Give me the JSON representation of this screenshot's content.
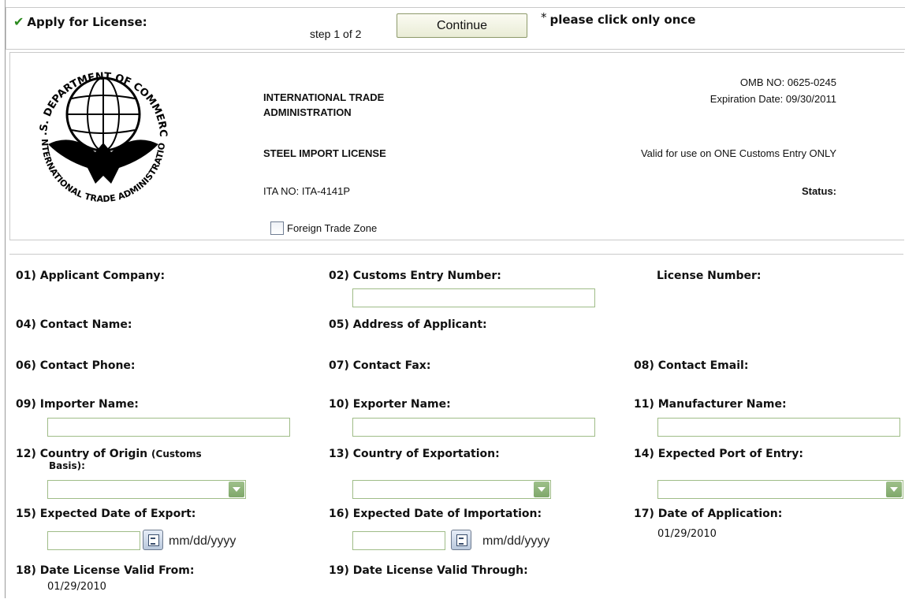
{
  "topbar": {
    "apply_label": "Apply for License:",
    "step_text": "step 1 of 2",
    "continue_label": "Continue",
    "note_asterisk": "*",
    "note_text": "please click only once"
  },
  "header": {
    "agency_line1": "INTERNATIONAL TRADE",
    "agency_line2": "ADMINISTRATION",
    "license_title": "STEEL IMPORT LICENSE",
    "ita_no": "ITA NO: ITA-4141P",
    "omb_no": "OMB NO: 0625-0245",
    "expiration": "Expiration Date: 09/30/2011",
    "valid_note": "Valid for use on ONE Customs Entry ONLY",
    "status_label": "Status:",
    "foreign_trade_zone": "Foreign Trade Zone",
    "seal_text": "U.S. DEPARTMENT OF COMMERCE · INTERNATIONAL TRADE ADMINISTRATION"
  },
  "form": {
    "f01": "01) Applicant Company:",
    "f02": "02) Customs Entry Number:",
    "license_number": "License Number:",
    "f04": "04) Contact Name:",
    "f05": "05) Address of Applicant:",
    "f06": "06) Contact Phone:",
    "f07": "07) Contact Fax:",
    "f08": "08) Contact Email:",
    "f09": "09) Importer Name:",
    "f10": "10) Exporter Name:",
    "f11": "11) Manufacturer Name:",
    "f12": "12) Country of Origin",
    "f12_small": "(Customs",
    "f12_line2": "Basis):",
    "f13": "13) Country of Exportation:",
    "f14": "14) Expected Port of Entry:",
    "f15": "15) Expected Date of Export:",
    "f16": "16) Expected Date of Importation:",
    "f17": "17) Date of Application:",
    "f17_value": "01/29/2010",
    "f18": "18) Date License Valid From:",
    "f18_value": "01/29/2010",
    "f19": "19) Date License Valid Through:",
    "date_format": "mm/dd/yyyy"
  },
  "colors": {
    "check": "#2c8a1f",
    "input_border": "#9fbc87",
    "select_arrow": "#7fa86a"
  }
}
